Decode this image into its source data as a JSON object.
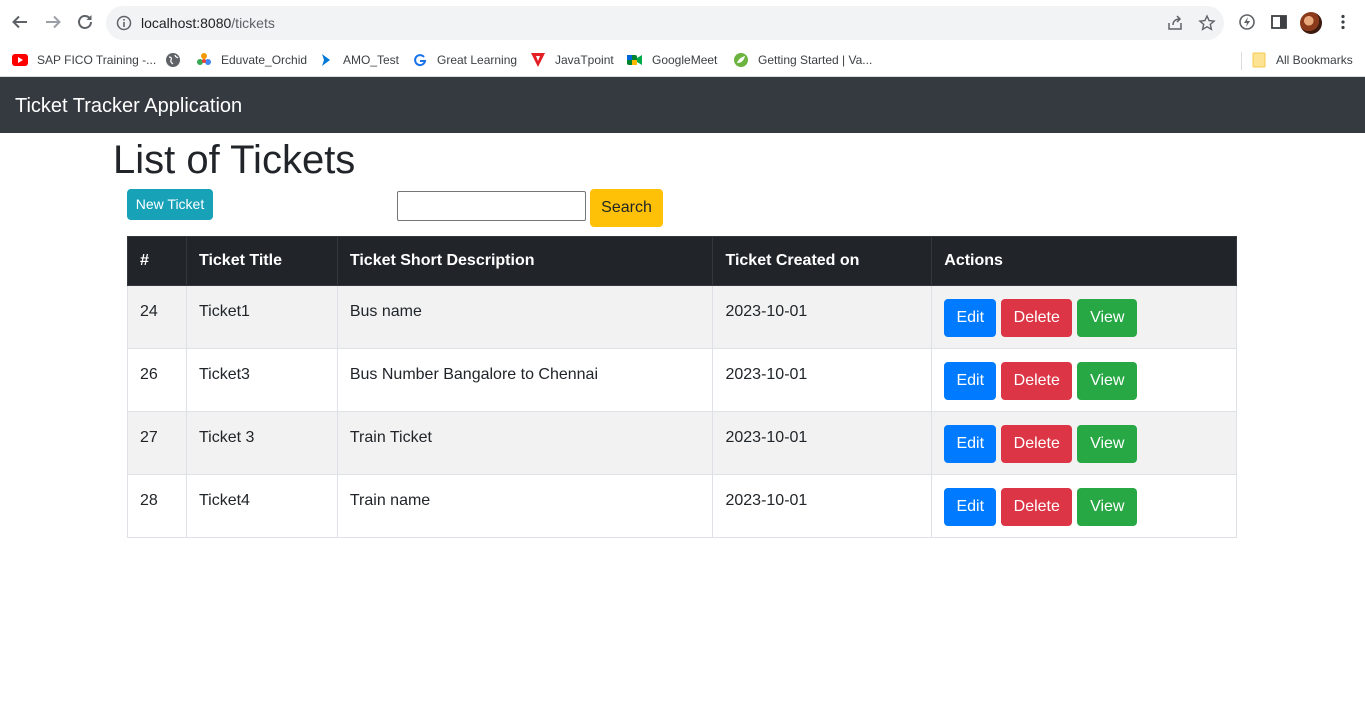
{
  "browser": {
    "url_host": "localhost:8080",
    "url_path": "/tickets",
    "bookmarks": [
      {
        "label": "SAP FICO Training -...",
        "icon": "youtube-icon"
      },
      {
        "label": "",
        "icon": "globe-icon"
      },
      {
        "label": "Eduvate_Orchid",
        "icon": "orchid-icon"
      },
      {
        "label": "AMO_Test",
        "icon": "azure-devops-icon"
      },
      {
        "label": "Great Learning",
        "icon": "great-learning-icon"
      },
      {
        "label": "JavaTpoint",
        "icon": "javatpoint-icon"
      },
      {
        "label": "GoogleMeet",
        "icon": "google-meet-icon"
      },
      {
        "label": "Getting Started | Va...",
        "icon": "spring-leaf-icon"
      }
    ],
    "all_bookmarks_label": "All Bookmarks"
  },
  "app": {
    "brand": "Ticket Tracker Application",
    "page_title": "List of Tickets",
    "new_ticket_label": "New Ticket",
    "search_value": "",
    "search_label": "Search",
    "table": {
      "headers": [
        "#",
        "Ticket Title",
        "Ticket Short Description",
        "Ticket Created on",
        "Actions"
      ],
      "rows": [
        {
          "id": "24",
          "title": "Ticket1",
          "description": "Bus name",
          "created_on": "2023-10-01"
        },
        {
          "id": "26",
          "title": "Ticket3",
          "description": "Bus Number Bangalore to Chennai",
          "created_on": "2023-10-01"
        },
        {
          "id": "27",
          "title": "Ticket 3",
          "description": "Train Ticket",
          "created_on": "2023-10-01"
        },
        {
          "id": "28",
          "title": "Ticket4",
          "description": "Train name",
          "created_on": "2023-10-01"
        }
      ],
      "action_labels": {
        "edit": "Edit",
        "delete": "Delete",
        "view": "View"
      }
    }
  },
  "colors": {
    "navbar": "#343a40",
    "table_header": "#212529",
    "edit": "#007bff",
    "delete": "#dc3545",
    "view": "#28a745",
    "search": "#ffc107",
    "new_ticket": "#17a2b8"
  }
}
